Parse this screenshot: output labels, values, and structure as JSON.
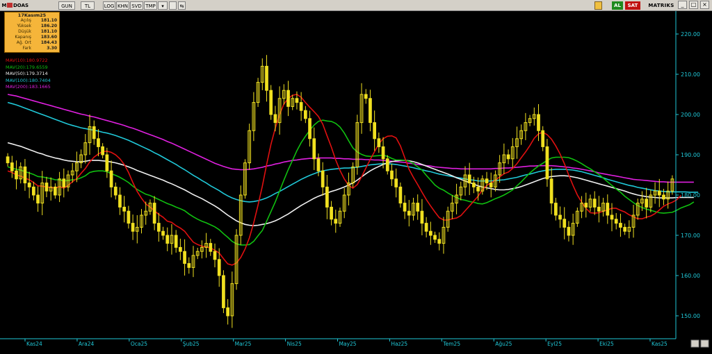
{
  "toolbar": {
    "symbol": "DOAS",
    "period": "GUN",
    "currency": "TL",
    "buttons": [
      "LOG",
      "KHN",
      "SVD",
      "TMP"
    ],
    "al": "AL",
    "sat": "SAT",
    "brand": "MATRIKS",
    "colors": {
      "al": "#1e8a1e",
      "sat": "#c01010"
    }
  },
  "infobox": {
    "title": "17Kasım25",
    "rows": [
      {
        "label": "Açılış",
        "value": "181.10"
      },
      {
        "label": "Yüksek",
        "value": "186.20"
      },
      {
        "label": "Düşük",
        "value": "181.10"
      },
      {
        "label": "Kapanış",
        "value": "183.60"
      },
      {
        "label": "Ağ. Ort",
        "value": "184.43"
      },
      {
        "label": "Fark",
        "value": "3.30"
      }
    ]
  },
  "legend": [
    {
      "label": "MAV(10)",
      "value": ":180.9722",
      "color": "#e01010"
    },
    {
      "label": "MAV(20)",
      "value": ":179.6559",
      "color": "#10c010"
    },
    {
      "label": "MAV(50)",
      "value": ":179.3714",
      "color": "#f0f0f0"
    },
    {
      "label": "MAV(100)",
      "value": ":180.7404",
      "color": "#20c8d8"
    },
    {
      "label": "MAV(200)",
      "value": ":183.1665",
      "color": "#e020e0"
    }
  ],
  "chart_data": {
    "type": "candlestick",
    "series_color": "#f0e020",
    "axis_color": "#20c8d8",
    "ylim": [
      145,
      225
    ],
    "yticks": [
      150,
      160,
      170,
      180,
      190,
      200,
      210,
      220
    ],
    "x_labels": [
      "Kas24",
      "Ara24",
      "Oca25",
      "Şub25",
      "Mar25",
      "Nis25",
      "May25",
      "Haz25",
      "Tem25",
      "Ağu25",
      "Eyl25",
      "Eki25",
      "Kas25"
    ],
    "closes": [
      188,
      186,
      184,
      187,
      183,
      182,
      180,
      178,
      183,
      181,
      182,
      180,
      184,
      182,
      185,
      186,
      188,
      190,
      193,
      197,
      194,
      192,
      190,
      186,
      182,
      180,
      177,
      176,
      173,
      171,
      172,
      175,
      176,
      178,
      173,
      171,
      170,
      168,
      170,
      167,
      166,
      163,
      162,
      165,
      166,
      167,
      168,
      166,
      164,
      160,
      152,
      150,
      158,
      170,
      180,
      188,
      196,
      203,
      208,
      212,
      206,
      200,
      198,
      204,
      206,
      202,
      204,
      203,
      201,
      199,
      194,
      189,
      186,
      182,
      177,
      174,
      173,
      176,
      180,
      183,
      187,
      198,
      205,
      204,
      198,
      194,
      192,
      189,
      186,
      184,
      182,
      178,
      176,
      175,
      178,
      176,
      173,
      171,
      170,
      169,
      168,
      172,
      176,
      178,
      180,
      182,
      185,
      183,
      182,
      181,
      184,
      183,
      182,
      185,
      188,
      190,
      189,
      192,
      194,
      196,
      198,
      199,
      200,
      196,
      192,
      184,
      178,
      175,
      174,
      172,
      170,
      173,
      176,
      178,
      177,
      179,
      177,
      176,
      178,
      175,
      174,
      173,
      172,
      171,
      172,
      175,
      178,
      179,
      177,
      180,
      181,
      180,
      179,
      181,
      184
    ],
    "ma": {
      "MAV(10)": [
        186,
        185.6,
        185,
        184.7,
        184.2,
        183.8,
        183.1,
        182.3,
        182.2,
        182,
        181.9,
        181.7,
        182.1,
        181.7,
        182.4,
        183.3,
        184.1,
        185.4,
        186.6,
        188.2,
        189.4,
        190.2,
        190.8,
        190.9,
        190.6,
        190,
        189,
        187.6,
        185.6,
        183.1,
        180.9,
        179.2,
        177.8,
        177,
        176.1,
        175.2,
        174.5,
        173.5,
        173.2,
        172.4,
        171.8,
        171,
        169.6,
        168.3,
        167.7,
        167.3,
        167.1,
        166.9,
        166.3,
        165.6,
        164.2,
        162.9,
        162.6,
        163.1,
        164.5,
        166.6,
        169.4,
        173.1,
        177.5,
        182.2,
        187.6,
        192.6,
        196.6,
        200,
        202.6,
        204,
        204.8,
        205,
        204.3,
        203,
        201.8,
        200.7,
        199.5,
        197.6,
        194.7,
        191.9,
        188.7,
        186.1,
        184,
        182.4,
        181.7,
        182.6,
        184.5,
        186.7,
        188.8,
        190.8,
        192.7,
        194,
        194.6,
        194.7,
        194.2,
        192.2,
        189.3,
        186.4,
        184.4,
        182.6,
        180.7,
        178.9,
        177.3,
        175.8,
        174.4,
        173.8,
        173.8,
        174.1,
        174.3,
        174.9,
        176.1,
        177.3,
        178.5,
        179.7,
        181.3,
        182.4,
        183,
        183.7,
        184.5,
        185.3,
        185.7,
        186.6,
        187.8,
        189.3,
        190.7,
        192.3,
        194.1,
        195.2,
        195.6,
        195,
        193.9,
        192.2,
        190.2,
        187.8,
        185,
        182.4,
        180,
        178.2,
        176.7,
        175.6,
        175.5,
        175.6,
        176,
        176.3,
        176.7,
        176.7,
        176.2,
        175.8,
        175.1,
        174.6,
        174.1,
        174.1,
        174.5,
        174.8,
        175.4,
        176.3,
        177.2,
        177.8,
        178.2,
        178.8,
        179.9
      ],
      "MAV(20)": [
        187,
        186.7,
        186.4,
        186.2,
        185.8,
        185.5,
        185.1,
        184.6,
        184.5,
        184.3,
        184.1,
        183.8,
        183.8,
        183.5,
        183.6,
        183.8,
        183.9,
        184.3,
        184.8,
        185.6,
        185.9,
        186,
        186,
        185.8,
        185.3,
        184.9,
        184.4,
        183.8,
        183.1,
        182.2,
        181.4,
        180.8,
        180.2,
        179.9,
        179.4,
        178.9,
        178.4,
        177.9,
        177.5,
        177,
        176.6,
        176.1,
        175.3,
        174.6,
        174,
        173.5,
        173.1,
        172.6,
        172.1,
        171.4,
        170.4,
        169.5,
        168.5,
        167.9,
        167.6,
        167.6,
        167.7,
        168.5,
        169.9,
        171.2,
        173.5,
        175.9,
        178.3,
        181,
        183.7,
        186.3,
        188.6,
        191,
        193,
        194.6,
        196.1,
        197.4,
        198.3,
        198.6,
        198.4,
        198.3,
        197.8,
        196.9,
        195.4,
        193.5,
        191.7,
        190.7,
        190.1,
        189.7,
        189.6,
        189.7,
        189.8,
        189.9,
        189.6,
        189.1,
        188.7,
        188.7,
        188.6,
        188.4,
        187.8,
        187,
        186.2,
        184.9,
        183.7,
        182.5,
        181.7,
        181.2,
        180.5,
        179.9,
        179.4,
        178.9,
        178.7,
        178.4,
        178.2,
        177.9,
        177.8,
        178.1,
        178.6,
        179.1,
        179.5,
        180,
        180.6,
        181.3,
        182.3,
        183.3,
        184.4,
        185.5,
        186.4,
        187.2,
        187.9,
        188.6,
        189.2,
        189.4,
        189.4,
        189.4,
        189.3,
        188.9,
        188.4,
        187.8,
        187.1,
        186.5,
        185.8,
        185.1,
        184.2,
        183.3,
        182.4,
        181.5,
        180.7,
        179.7,
        178.9,
        178.1,
        177.4,
        176.9,
        176.5,
        176.2,
        175.9,
        175.6,
        175.5,
        175.6,
        175.7,
        176.2,
        176.8,
        177.2,
        177.6,
        178.3
      ],
      "MAV(50)": [
        193,
        192.7,
        192.4,
        192.1,
        191.7,
        191.3,
        190.9,
        190.5,
        190.2,
        189.8,
        189.5,
        189.2,
        189,
        188.7,
        188.5,
        188.4,
        188.3,
        188.3,
        188.4,
        188.6,
        188.6,
        188.6,
        188.5,
        188.4,
        188.2,
        188,
        187.7,
        187.4,
        187,
        186.6,
        186.1,
        185.7,
        185.3,
        184.9,
        184.5,
        184.1,
        183.7,
        183.2,
        182.8,
        182.3,
        181.8,
        181.3,
        180.7,
        180.1,
        179.6,
        179.1,
        178.5,
        177.9,
        177.3,
        176.6,
        175.8,
        175,
        174.3,
        173.6,
        173.1,
        172.7,
        172.5,
        172.4,
        172.5,
        172.7,
        172.9,
        173.2,
        173.6,
        174.1,
        174.7,
        175.3,
        176,
        176.7,
        177.4,
        178,
        178.6,
        179.2,
        179.7,
        180.1,
        180.5,
        180.9,
        181.2,
        181.6,
        182,
        182.5,
        183,
        183.7,
        184.5,
        185.3,
        186,
        186.6,
        187.1,
        187.6,
        188,
        188.3,
        188.5,
        188.6,
        188.6,
        188.5,
        188.3,
        188,
        187.6,
        187.2,
        186.8,
        186.4,
        186,
        185.6,
        185.2,
        184.8,
        184.3,
        183.9,
        183.5,
        183.1,
        182.7,
        182.3,
        182,
        181.8,
        181.6,
        181.4,
        181.3,
        181.3,
        181.4,
        181.6,
        181.8,
        182.1,
        182.5,
        182.9,
        183.3,
        183.7,
        184.1,
        184.4,
        184.6,
        184.7,
        184.8,
        184.8,
        184.7,
        184.5,
        184.3,
        184,
        183.7,
        183.4,
        183.1,
        182.8,
        182.5,
        182.2,
        181.9,
        181.6,
        181.3,
        181,
        180.6,
        180.3,
        180,
        179.8,
        179.6,
        179.5,
        179.4,
        179.3,
        179.3,
        179.3,
        179.3,
        179.4,
        179.4,
        179.4,
        179.4,
        179.4
      ],
      "MAV(100)": [
        203,
        202.7,
        202.4,
        202,
        201.6,
        201.2,
        200.8,
        200.4,
        200,
        199.6,
        199.2,
        198.8,
        198.4,
        198,
        197.6,
        197.3,
        197,
        196.7,
        196.5,
        196.3,
        196.1,
        195.9,
        195.6,
        195.4,
        195.1,
        194.8,
        194.4,
        194,
        193.6,
        193.1,
        192.6,
        192.1,
        191.6,
        191.1,
        190.5,
        190,
        189.4,
        188.8,
        188.2,
        187.6,
        186.9,
        186.3,
        185.6,
        184.9,
        184.3,
        183.6,
        183,
        182.3,
        181.7,
        181.1,
        180.4,
        179.8,
        179.3,
        178.9,
        178.6,
        178.4,
        178.3,
        178.4,
        178.6,
        178.9,
        179.3,
        179.8,
        180.4,
        180.9,
        181.5,
        182.1,
        182.7,
        183.3,
        183.9,
        184.4,
        184.9,
        185.3,
        185.7,
        186,
        186.2,
        186.4,
        186.5,
        186.6,
        186.7,
        186.7,
        186.8,
        186.9,
        187.1,
        187.3,
        187.5,
        187.6,
        187.7,
        187.8,
        187.8,
        187.7,
        187.6,
        187.4,
        187.2,
        187,
        186.8,
        186.5,
        186.3,
        186,
        185.8,
        185.5,
        185.2,
        185,
        184.8,
        184.6,
        184.4,
        184.2,
        184,
        183.8,
        183.7,
        183.5,
        183.5,
        183.5,
        183.5,
        183.6,
        183.7,
        183.8,
        184,
        184.2,
        184.4,
        184.7,
        185,
        185.2,
        185.5,
        185.8,
        186,
        186.2,
        186.3,
        186.4,
        186.4,
        186.4,
        186.3,
        186.2,
        186,
        185.8,
        185.5,
        185.2,
        184.9,
        184.6,
        184.3,
        183.9,
        183.6,
        183.3,
        183,
        182.7,
        182.4,
        182.2,
        181.9,
        181.7,
        181.5,
        181.3,
        181.1,
        181,
        180.9,
        180.8,
        180.8,
        180.8,
        180.8,
        180.8,
        180.7,
        180.7,
        180.7
      ],
      "MAV(200)": [
        205,
        204.8,
        204.6,
        204.3,
        204,
        203.7,
        203.4,
        203.1,
        202.8,
        202.5,
        202.2,
        201.9,
        201.6,
        201.3,
        201,
        200.7,
        200.4,
        200.1,
        199.9,
        199.6,
        199.4,
        199.1,
        198.8,
        198.5,
        198.2,
        197.9,
        197.6,
        197.3,
        196.9,
        196.6,
        196.2,
        195.8,
        195.4,
        195,
        194.6,
        194.2,
        193.8,
        193.3,
        192.9,
        192.4,
        191.9,
        191.4,
        190.9,
        190.4,
        189.9,
        189.4,
        188.9,
        188.4,
        187.9,
        187.5,
        187.1,
        186.8,
        186.5,
        186.4,
        186.3,
        186.3,
        186.4,
        186.5,
        186.7,
        186.9,
        187.2,
        187.4,
        187.7,
        187.9,
        188.2,
        188.4,
        188.6,
        188.7,
        188.9,
        189,
        189.1,
        189.1,
        189.2,
        189.2,
        189.2,
        189.2,
        189.1,
        189.1,
        189,
        189,
        188.9,
        188.9,
        188.9,
        188.8,
        188.8,
        188.7,
        188.7,
        188.6,
        188.5,
        188.4,
        188.3,
        188.2,
        188.1,
        187.9,
        187.8,
        187.6,
        187.5,
        187.3,
        187.2,
        187,
        186.9,
        186.8,
        186.7,
        186.6,
        186.6,
        186.5,
        186.5,
        186.5,
        186.5,
        186.5,
        186.5,
        186.5,
        186.5,
        186.6,
        186.6,
        186.7,
        186.7,
        186.8,
        186.9,
        187,
        187.1,
        187.2,
        187.2,
        187.3,
        187.3,
        187.3,
        187.3,
        187.2,
        187.1,
        187,
        186.9,
        186.7,
        186.6,
        186.4,
        186.2,
        186,
        185.8,
        185.5,
        185.3,
        185.1,
        184.9,
        184.7,
        184.5,
        184.3,
        184.1,
        183.9,
        183.8,
        183.7,
        183.6,
        183.5,
        183.4,
        183.3,
        183.3,
        183.2,
        183.2,
        183.2,
        183.2,
        183.2,
        183.2,
        183.2
      ]
    }
  }
}
